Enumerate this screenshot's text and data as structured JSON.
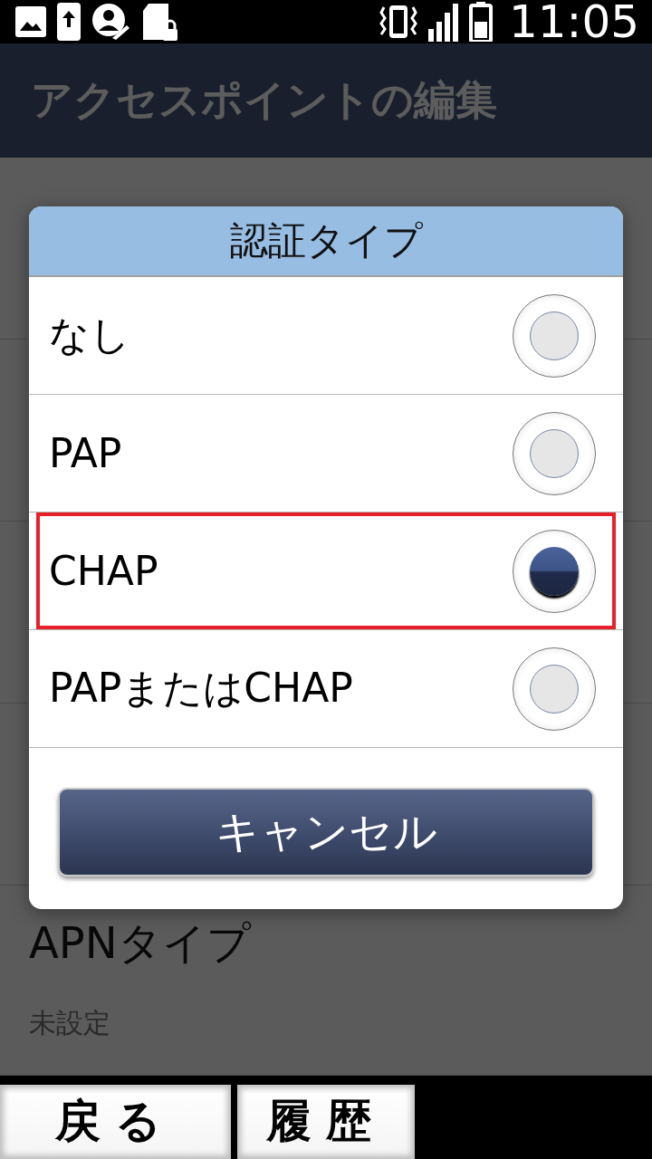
{
  "status_bar": {
    "time": "11:05"
  },
  "title": "アクセスポイントの編集",
  "background_items": [
    {
      "label": "APNタイプ",
      "value": "未設定"
    }
  ],
  "dialog": {
    "title": "認証タイプ",
    "options": [
      {
        "label": "なし",
        "selected": false,
        "highlighted": false
      },
      {
        "label": "PAP",
        "selected": false,
        "highlighted": false
      },
      {
        "label": "CHAP",
        "selected": true,
        "highlighted": true
      },
      {
        "label": "PAPまたはCHAP",
        "selected": false,
        "highlighted": false
      }
    ],
    "cancel": "キャンセル"
  },
  "bottom_buttons": [
    "戻る",
    "履歴"
  ]
}
